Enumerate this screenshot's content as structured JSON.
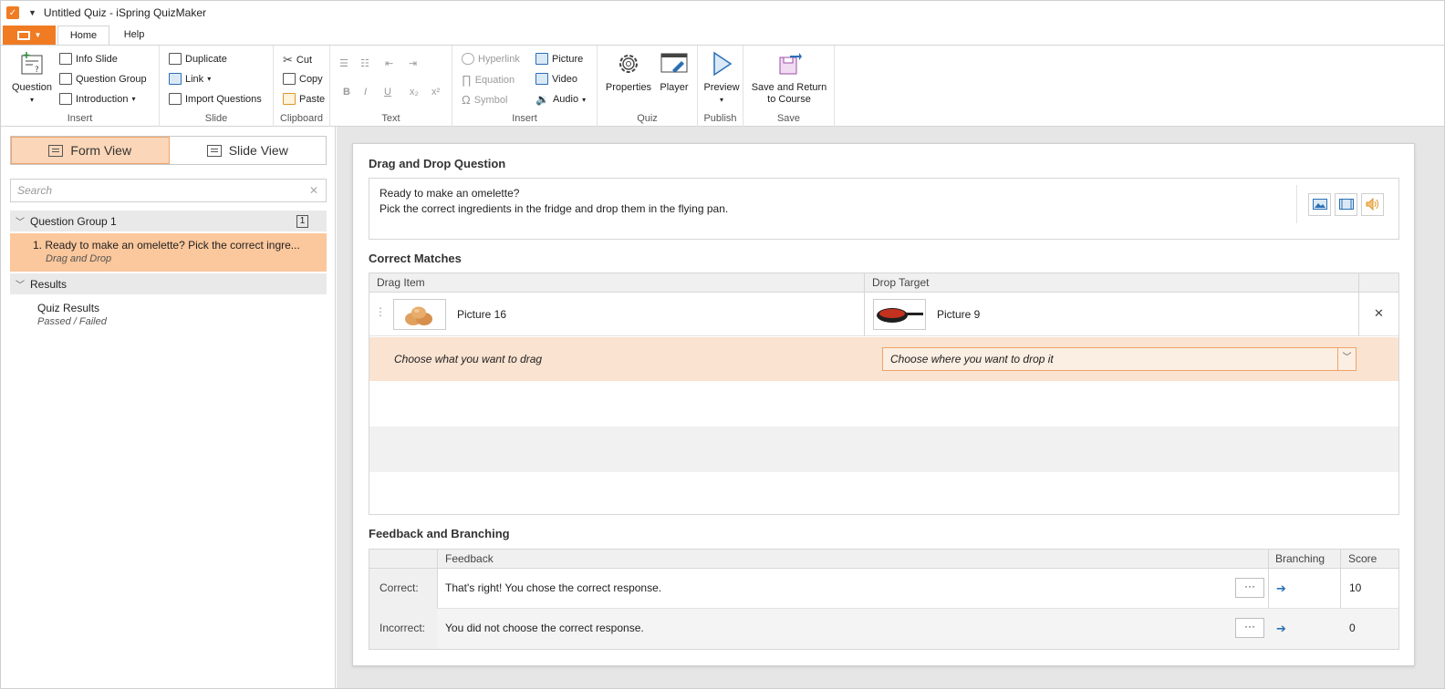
{
  "window": {
    "title": "Untitled Quiz - iSpring QuizMaker"
  },
  "ribbon": {
    "tabs": [
      "Home",
      "Help"
    ],
    "groups": {
      "insert1": {
        "label": "Insert",
        "question": "Question",
        "info_slide": "Info Slide",
        "question_group": "Question Group",
        "introduction": "Introduction"
      },
      "slide": {
        "label": "Slide",
        "duplicate": "Duplicate",
        "link": "Link",
        "import": "Import Questions"
      },
      "clipboard": {
        "label": "Clipboard",
        "cut": "Cut",
        "copy": "Copy",
        "paste": "Paste"
      },
      "text": {
        "label": "Text"
      },
      "insert2": {
        "label": "Insert",
        "hyperlink": "Hyperlink",
        "equation": "Equation",
        "symbol": "Symbol",
        "picture": "Picture",
        "video": "Video",
        "audio": "Audio"
      },
      "quiz": {
        "label": "Quiz",
        "properties": "Properties",
        "player": "Player"
      },
      "publish": {
        "label": "Publish",
        "preview": "Preview"
      },
      "save": {
        "label": "Save",
        "save_return_1": "Save and Return",
        "save_return_2": "to Course"
      }
    }
  },
  "left": {
    "form_view": "Form View",
    "slide_view": "Slide View",
    "search_placeholder": "Search",
    "group1": {
      "title": "Question Group 1",
      "count": "1"
    },
    "item1": {
      "title": "1.  Ready to make an omelette? Pick the correct ingre...",
      "subtitle": "Drag and Drop"
    },
    "results": {
      "title": "Results"
    },
    "quiz_results": {
      "title": "Quiz Results",
      "subtitle": "Passed / Failed"
    }
  },
  "main": {
    "question_title": "Drag and Drop Question",
    "question_line1": "Ready to make an omelette?",
    "question_line2": "Pick the correct ingredients in the fridge and drop them in the flying pan.",
    "correct_matches": "Correct Matches",
    "col_drag": "Drag Item",
    "col_drop": "Drop Target",
    "match1": {
      "drag": "Picture 16",
      "drop": "Picture 9"
    },
    "choose_drag": "Choose what you want to drag",
    "choose_drop": "Choose where you want to drop it",
    "feedback_title": "Feedback and Branching",
    "fb_cols": {
      "feedback": "Feedback",
      "branching": "Branching",
      "score": "Score"
    },
    "fb_rows": [
      {
        "label": "Correct:",
        "text": "That's right! You chose the correct response.",
        "score": "10"
      },
      {
        "label": "Incorrect:",
        "text": "You did not choose the correct response.",
        "score": "0"
      }
    ]
  }
}
